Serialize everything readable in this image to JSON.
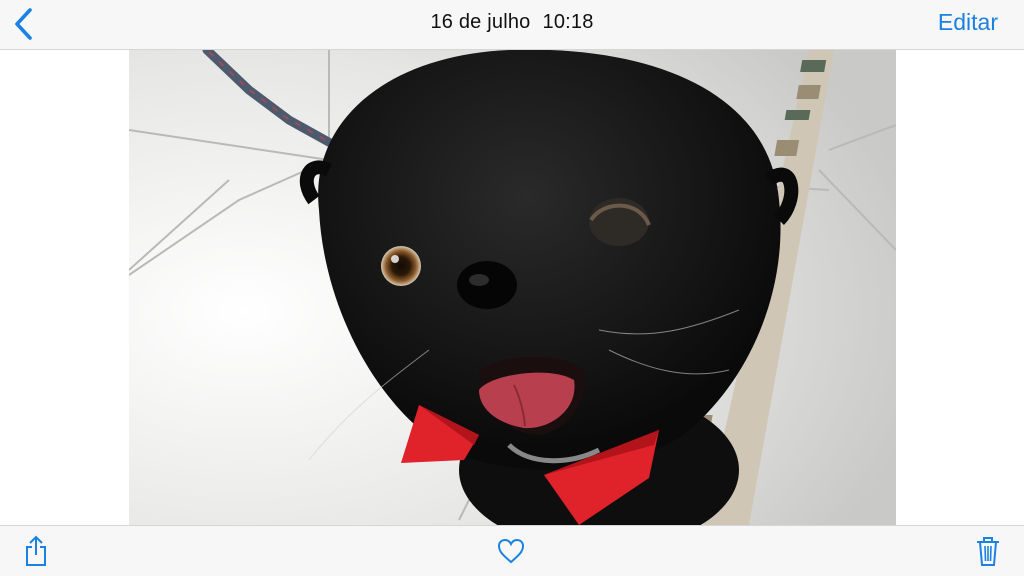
{
  "nav": {
    "date": "16 de julho",
    "time": "10:18",
    "edit_label": "Editar",
    "back_icon": "chevron-left-icon"
  },
  "photo": {
    "subject_icon": "photo-black-pekingese-dog-with-red-bow-tie"
  },
  "toolbar": {
    "share_icon": "share-icon",
    "favorite_icon": "heart-icon",
    "delete_icon": "trash-icon"
  },
  "colors": {
    "accent": "#1a82e2",
    "bar_background": "#f7f7f7",
    "bow_tie": "#e0222a",
    "dog_fur": "#161616"
  }
}
